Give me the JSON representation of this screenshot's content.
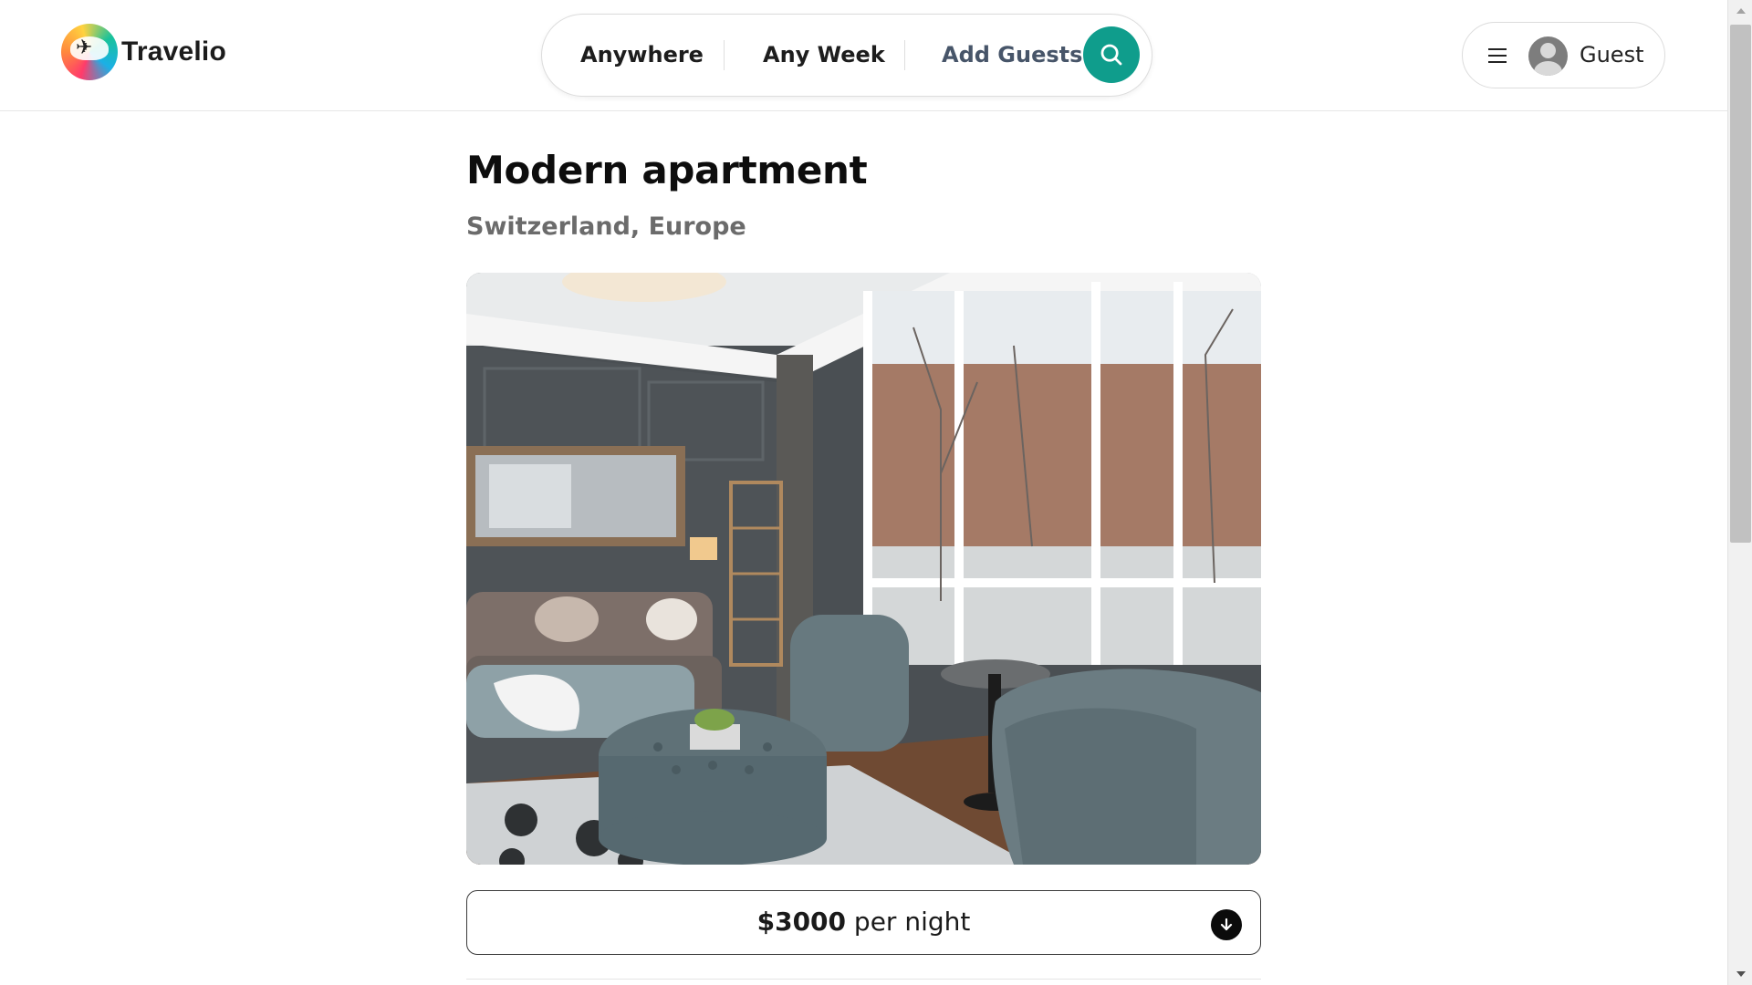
{
  "header": {
    "brand": "Travelio",
    "search": {
      "location": "Anywhere",
      "dates": "Any Week",
      "guests": "Add Guests",
      "accent_color": "#0f9d8c"
    },
    "user_menu": {
      "label": "Guest"
    }
  },
  "listing": {
    "title": "Modern apartment",
    "location": "Switzerland, Europe",
    "photo": "living-room-photo",
    "price": {
      "amount": "$3000",
      "unit": " per night"
    }
  },
  "icons": {
    "search": "search-icon",
    "menu": "hamburger-menu-icon",
    "avatar": "user-avatar-icon",
    "expand": "arrow-down-circle-icon",
    "logo": "plane-logo-icon"
  }
}
